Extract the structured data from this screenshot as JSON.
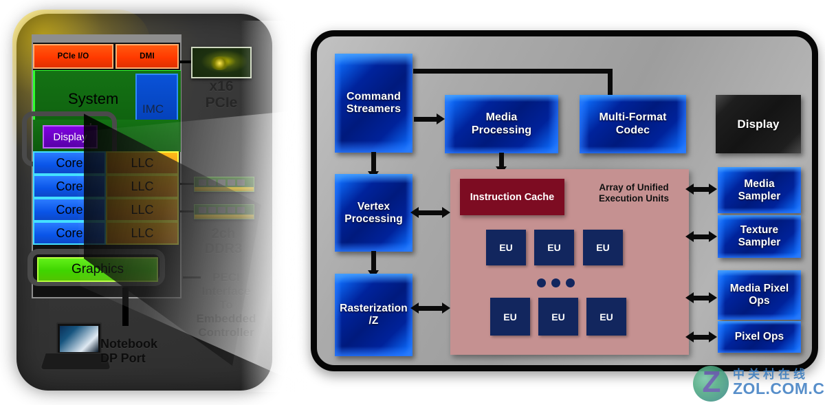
{
  "diagram": {
    "left_panel": {
      "name": "cpu-package-overview",
      "io_blocks": [
        {
          "label": "PCIe I/O",
          "color": "#ff3a00"
        },
        {
          "label": "DMI",
          "color": "#ff3a00"
        }
      ],
      "system_block": {
        "label": "System",
        "color": "#0d5a0d"
      },
      "imc_block": {
        "label": "IMC",
        "color": "#0038a8"
      },
      "display_block": {
        "label": "Display",
        "color": "#5800a8"
      },
      "core_rows": [
        {
          "core": "Core",
          "llc": "LLC"
        },
        {
          "core": "Core",
          "llc": "LLC"
        },
        {
          "core": "Core",
          "llc": "LLC"
        },
        {
          "core": "Core",
          "llc": "LLC"
        }
      ],
      "graphics_block": {
        "label": "Graphics",
        "color": "#3fd400"
      },
      "peripherals": [
        {
          "name": "x16-pcie",
          "label": "x16\nPCIe",
          "line1": "x16",
          "line2": "PCIe"
        },
        {
          "name": "ddr3-dimms",
          "label": "2ch DDR3",
          "line1": "2ch",
          "line2": "DDR3"
        },
        {
          "name": "peci-interface",
          "line1": "PECI",
          "line2": "Interface",
          "line3": "To",
          "line4": "Embedded",
          "line5": "Controller"
        },
        {
          "name": "notebook-dp-port",
          "line1": "Notebook",
          "line2": "DP Port"
        }
      ]
    },
    "right_panel": {
      "name": "gpu-block-diagram",
      "blocks": [
        {
          "id": "command-streamers",
          "label": "Command Streamers",
          "line1": "Command",
          "line2": "Streamers",
          "style": "blue"
        },
        {
          "id": "media-processing",
          "label": "Media Processing",
          "line1": "Media",
          "line2": "Processing",
          "style": "blue"
        },
        {
          "id": "multi-format-codec",
          "label": "Multi-Format Codec",
          "line1": "Multi-Format",
          "line2": "Codec",
          "style": "blue"
        },
        {
          "id": "display",
          "label": "Display",
          "line1": "Display",
          "line2": "",
          "style": "black"
        },
        {
          "id": "vertex-processing",
          "label": "Vertex Processing",
          "line1": "Vertex",
          "line2": "Processing",
          "style": "blue"
        },
        {
          "id": "rasterization-z",
          "label": "Rasterization /Z",
          "line1": "Rasterization",
          "line2": "/Z",
          "style": "blue"
        },
        {
          "id": "media-sampler",
          "label": "Media Sampler",
          "line1": "Media",
          "line2": "Sampler",
          "style": "blue"
        },
        {
          "id": "texture-sampler",
          "label": "Texture Sampler",
          "line1": "Texture",
          "line2": "Sampler",
          "style": "blue"
        },
        {
          "id": "media-pixel-ops",
          "label": "Media Pixel Ops",
          "line1": "Media Pixel",
          "line2": "Ops",
          "style": "blue"
        },
        {
          "id": "pixel-ops",
          "label": "Pixel Ops",
          "line1": "Pixel Ops",
          "line2": "",
          "style": "blue"
        }
      ],
      "eu_array": {
        "instruction_cache_label": "Instruction Cache",
        "array_label_line1": "Array of Unified",
        "array_label_line2": "Execution Units",
        "eu_label": "EU",
        "eu_count_top": 3,
        "eu_count_bottom": 3,
        "ellipsis_dots": 3,
        "background_color": "#c59191",
        "cache_color": "#7d0c22",
        "eu_color": "#12265e"
      }
    },
    "watermark": {
      "chinese": "中关村在线",
      "english": "ZOL.COM.CN",
      "mark": "Z"
    },
    "colors": {
      "blue_block": "#001a7d",
      "blue_edge": "#0b63ef",
      "panel_bg": "#a8a8a8",
      "panel_border": "#060606",
      "orange": "#f59500",
      "green": "#3fd400"
    }
  }
}
